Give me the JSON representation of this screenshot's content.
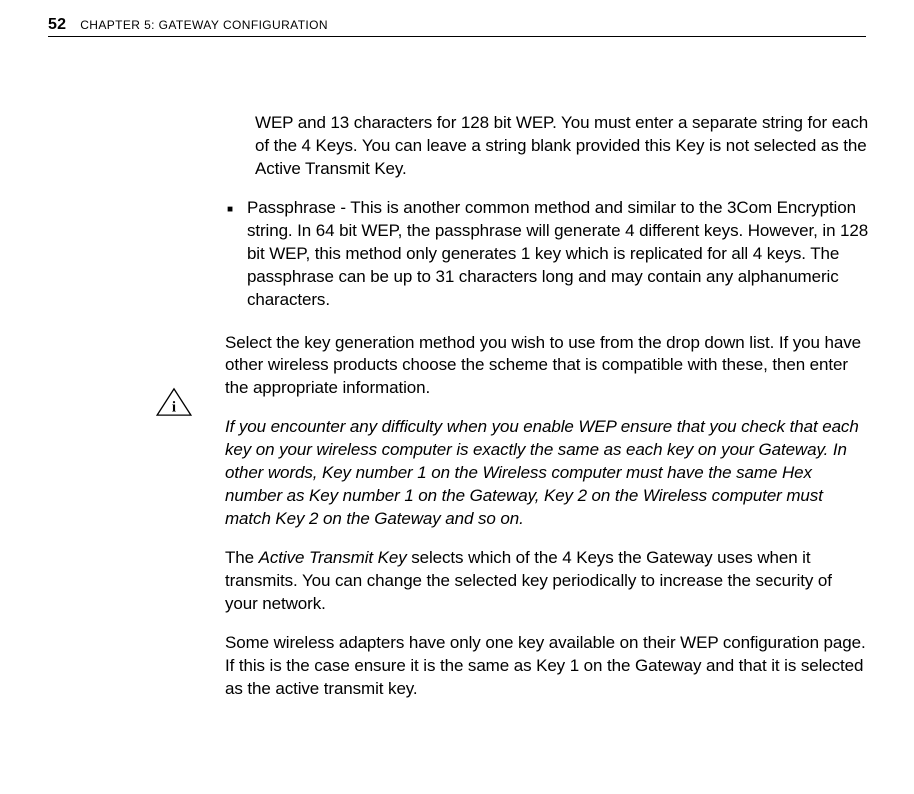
{
  "header": {
    "page_number": "52",
    "chapter_prefix": "C",
    "chapter_rest": "HAPTER",
    "chapter_num": " 5: G",
    "chapter_rest2": "ATEWAY",
    "chapter_rest3": " C",
    "chapter_rest4": "ONFIGURATION"
  },
  "body": {
    "p1": "WEP and 13 characters for 128 bit WEP. You must enter a separate string for each of the 4 Keys. You can leave a string blank provided this Key is not selected as the Active Transmit Key.",
    "bullet": "Passphrase - This is another common method and similar to the 3Com Encryption string. In 64 bit WEP, the passphrase will generate 4 different keys. However, in 128 bit WEP, this method only generates 1 key which is replicated for all 4 keys. The passphrase can be up to 31 characters long and may contain any alphanumeric characters.",
    "p2": "Select the key generation method you wish to use from the drop down list. If you have other wireless products choose the scheme that is compatible with these, then enter the appropriate information.",
    "note": "If you encounter any difficulty when you enable WEP ensure that you check that each key on your wireless computer is exactly the same as each key on your Gateway. In other words, Key number 1 on the Wireless computer must have the same Hex number as Key number 1 on the Gateway, Key 2 on the Wireless computer must match Key 2 on the Gateway and so on.",
    "p3a": "The ",
    "p3_italic": "Active Transmit Key",
    "p3b": " selects which of the 4 Keys the Gateway uses when it transmits. You can change the selected key periodically to increase the security of your network.",
    "p4": "Some wireless adapters have only one key available on their WEP configuration page. If this is the case ensure it is the same as Key 1 on the Gateway and that it is selected as the active transmit key."
  }
}
